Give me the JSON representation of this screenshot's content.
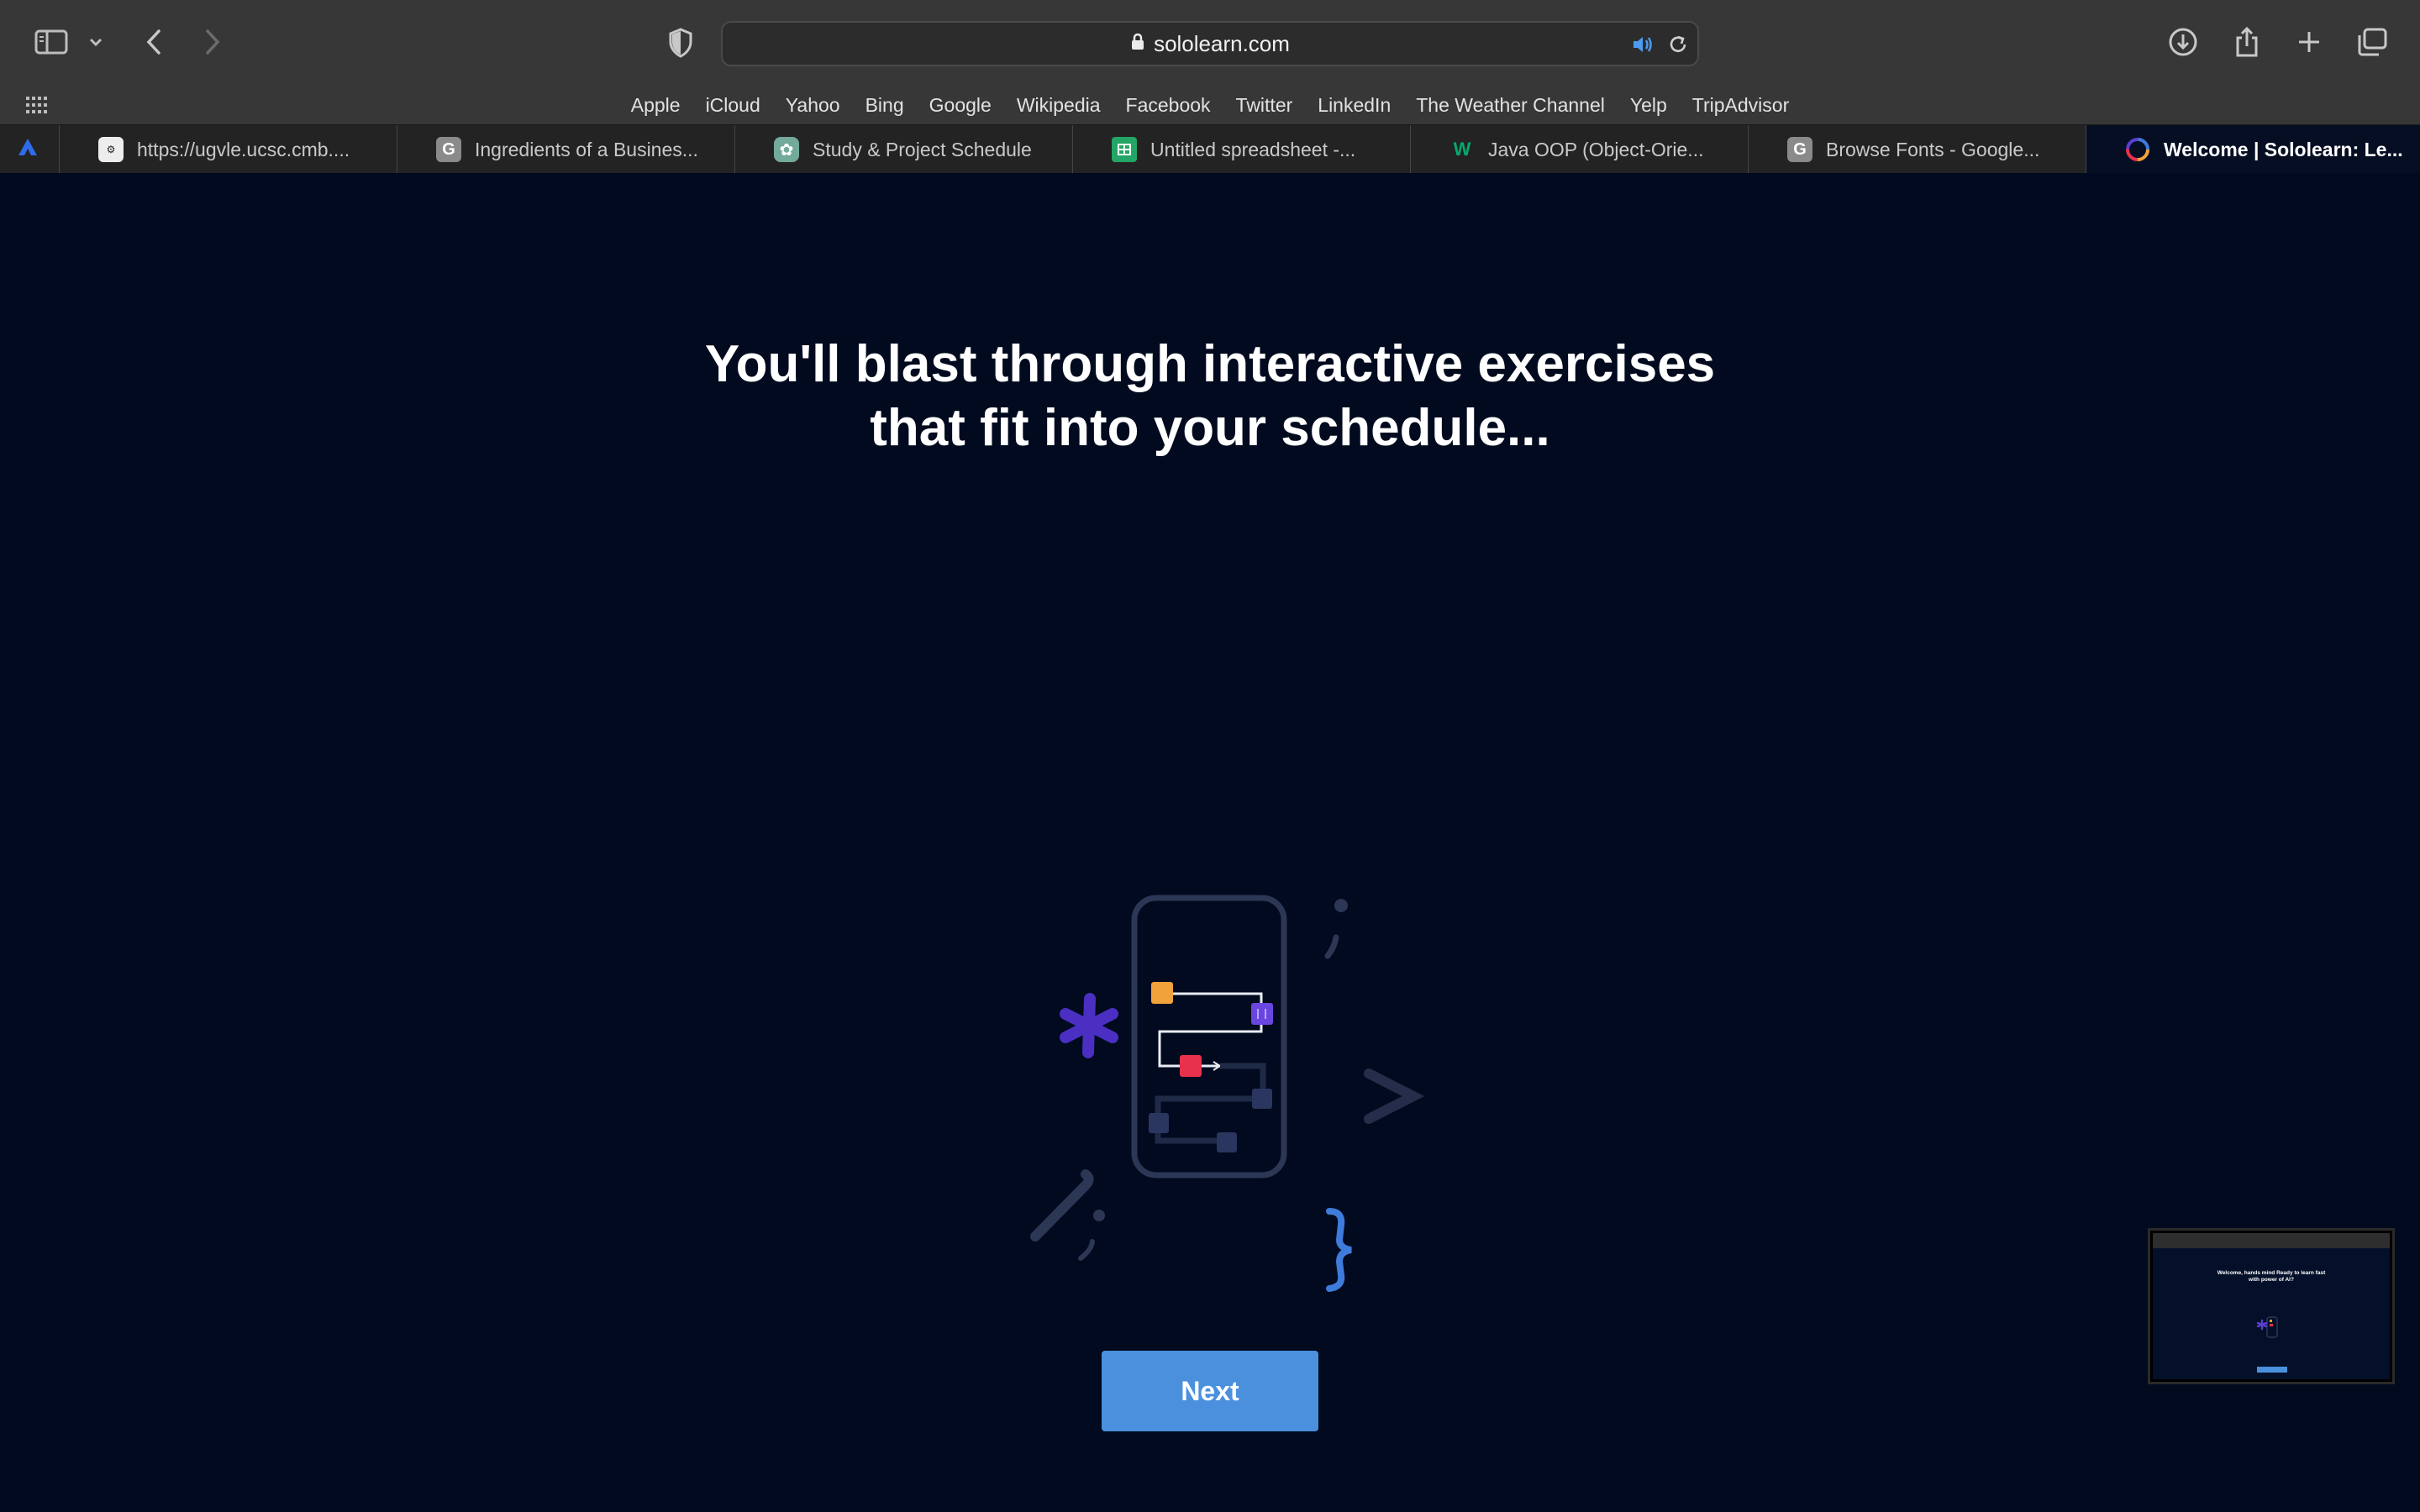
{
  "browser": {
    "address": "sololearn.com"
  },
  "bookmarks": [
    {
      "label": "Apple"
    },
    {
      "label": "iCloud"
    },
    {
      "label": "Yahoo"
    },
    {
      "label": "Bing"
    },
    {
      "label": "Google"
    },
    {
      "label": "Wikipedia"
    },
    {
      "label": "Facebook"
    },
    {
      "label": "Twitter"
    },
    {
      "label": "LinkedIn"
    },
    {
      "label": "The Weather Channel"
    },
    {
      "label": "Yelp"
    },
    {
      "label": "TripAdvisor"
    }
  ],
  "tabs": [
    {
      "title": "https://ugvle.ucsc.cmb....",
      "favicon": "ucsc-favicon-icon"
    },
    {
      "title": "Ingredients of a Busines...",
      "favicon": "G"
    },
    {
      "title": "Study & Project Schedule",
      "favicon": "chatgpt-favicon-icon"
    },
    {
      "title": "Untitled spreadsheet -...",
      "favicon": "sheets-favicon-icon"
    },
    {
      "title": "Java OOP (Object-Orie...",
      "favicon": "w3schools-favicon-icon"
    },
    {
      "title": "Browse Fonts - Google...",
      "favicon": "G"
    },
    {
      "title": "Welcome | Sololearn: Le...",
      "favicon": "sololearn-favicon-icon",
      "active": true
    }
  ],
  "page": {
    "headline_line1": "You'll blast through interactive exercises",
    "headline_line2": "that fit into your schedule...",
    "next_label": "Next"
  },
  "preview": {
    "title_line1": "Welcome, hands mind Ready to learn fast",
    "title_line2": "with power of AI?"
  },
  "colors": {
    "page_background": "#010A1E",
    "button": "#4A90DD",
    "accent_purple": "#5B3FD1",
    "accent_orange": "#F2A23A",
    "accent_red": "#E8314B",
    "accent_blue": "#3E7BDB"
  }
}
